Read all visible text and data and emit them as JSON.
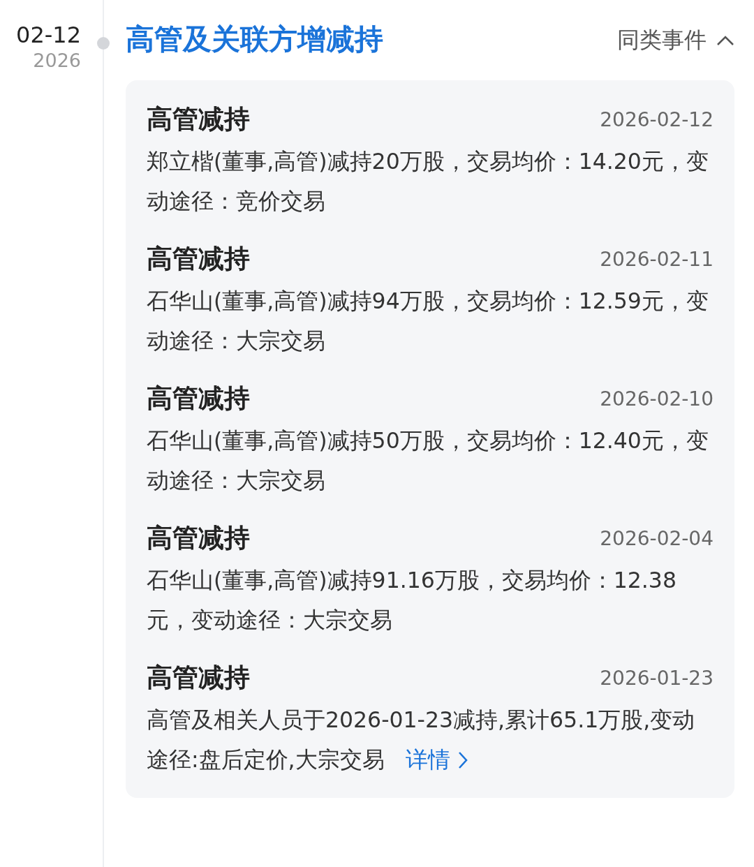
{
  "event": {
    "date": "02-12",
    "year": "2026",
    "title": "高管及关联方增减持",
    "same_events": {
      "label": "同类事件",
      "expanded": true
    }
  },
  "items": [
    {
      "title": "高管减持",
      "date": "2026-02-12",
      "desc": "郑立楷(董事,高管)减持20万股，交易均价：14.20元，变动途径：竞价交易"
    },
    {
      "title": "高管减持",
      "date": "2026-02-11",
      "desc": "石华山(董事,高管)减持94万股，交易均价：12.59元，变动途径：大宗交易"
    },
    {
      "title": "高管减持",
      "date": "2026-02-10",
      "desc": "石华山(董事,高管)减持50万股，交易均价：12.40元，变动途径：大宗交易"
    },
    {
      "title": "高管减持",
      "date": "2026-02-04",
      "desc": "石华山(董事,高管)减持91.16万股，交易均价：12.38元，变动途径：大宗交易"
    },
    {
      "title": "高管减持",
      "date": "2026-01-23",
      "desc": "高管及相关人员于2026-01-23减持,累计65.1万股,变动途径:盘后定价,大宗交易",
      "link": "详情"
    }
  ]
}
